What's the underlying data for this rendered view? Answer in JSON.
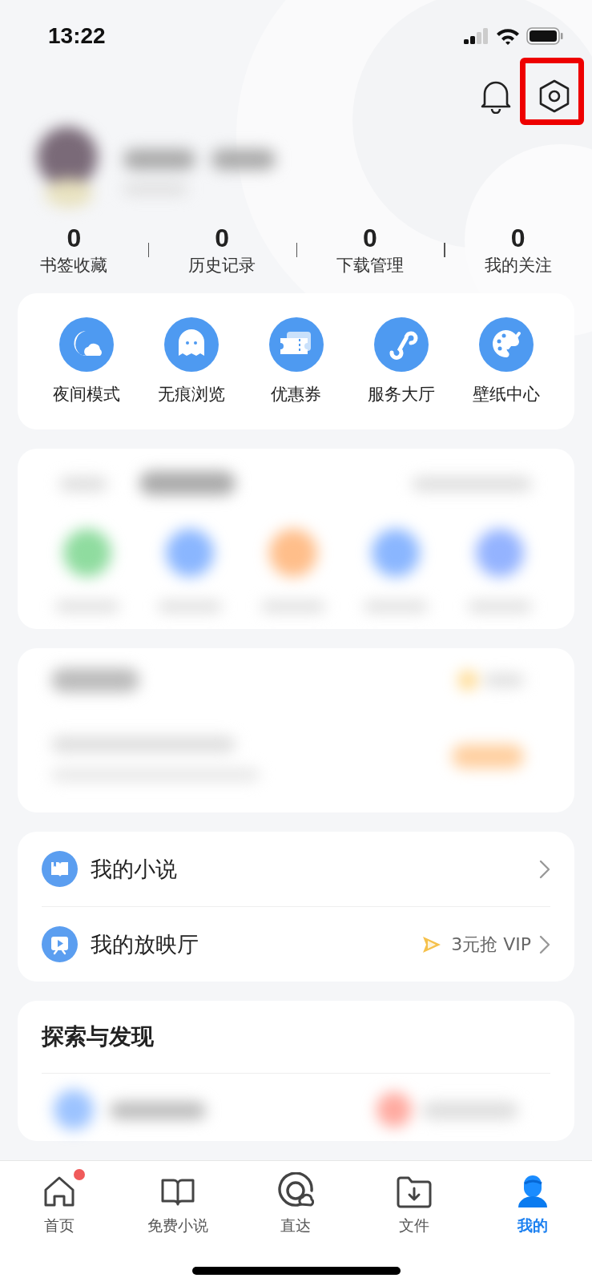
{
  "status_bar": {
    "time": "13:22"
  },
  "header": {
    "settings_highlighted": true
  },
  "stats": [
    {
      "value": "0",
      "label": "书签收藏"
    },
    {
      "value": "0",
      "label": "历史记录"
    },
    {
      "value": "0",
      "label": "下载管理"
    },
    {
      "value": "0",
      "label": "我的关注"
    }
  ],
  "quick_actions": [
    {
      "label": "夜间模式"
    },
    {
      "label": "无痕浏览"
    },
    {
      "label": "优惠券"
    },
    {
      "label": "服务大厅"
    },
    {
      "label": "壁纸中心"
    }
  ],
  "list": [
    {
      "label": "我的小说"
    },
    {
      "label": "我的放映厅",
      "promo": "3元抢 VIP"
    }
  ],
  "explore": {
    "title": "探索与发现"
  },
  "tabs": [
    {
      "label": "首页",
      "selected": false,
      "badge": true
    },
    {
      "label": "免费小说",
      "selected": false,
      "badge": false
    },
    {
      "label": "直达",
      "selected": false,
      "badge": false
    },
    {
      "label": "文件",
      "selected": false,
      "badge": false
    },
    {
      "label": "我的",
      "selected": true,
      "badge": false
    }
  ]
}
